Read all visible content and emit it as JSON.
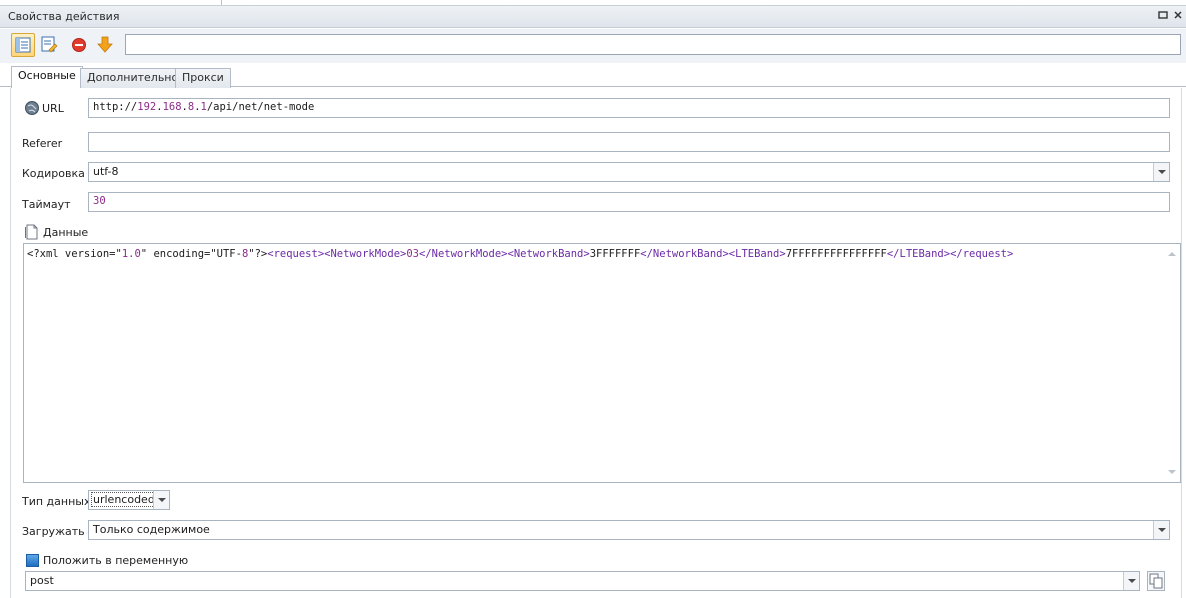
{
  "window": {
    "title": "Свойства действия"
  },
  "tabs": [
    {
      "label": "Основные"
    },
    {
      "label": "Дополнительно"
    },
    {
      "label": "Прокси"
    }
  ],
  "form": {
    "url_label": "URL",
    "url_prefix": "http://",
    "url_ip_a": "192",
    "url_dot1": ".",
    "url_ip_b": "168",
    "url_dot2": ".",
    "url_ip_c": "8",
    "url_dot3": ".",
    "url_ip_d": "1",
    "url_path": "/api/net/net-mode",
    "referer_label": "Referer",
    "referer_value": "",
    "encoding_label": "Кодировка",
    "encoding_value": "utf-8",
    "timeout_label": "Таймаут",
    "timeout_value": "30",
    "data_label": "Данные",
    "data_tokens": [
      {
        "t": "<?xml version=\"",
        "c": "txt"
      },
      {
        "t": "1.0",
        "c": "num"
      },
      {
        "t": "\" encoding=\"UTF-",
        "c": "txt"
      },
      {
        "t": "8",
        "c": "num"
      },
      {
        "t": "\"?>",
        "c": "txt"
      },
      {
        "t": "<request>",
        "c": "tag"
      },
      {
        "t": "<NetworkMode>",
        "c": "tag"
      },
      {
        "t": "03",
        "c": "num"
      },
      {
        "t": "</NetworkMode>",
        "c": "tag"
      },
      {
        "t": "<NetworkBand>",
        "c": "tag"
      },
      {
        "t": "3FFFFFFF",
        "c": "txt"
      },
      {
        "t": "</NetworkBand>",
        "c": "tag"
      },
      {
        "t": "<LTEBand>",
        "c": "tag"
      },
      {
        "t": "7FFFFFFFFFFFFFFF",
        "c": "txt"
      },
      {
        "t": "</LTEBand>",
        "c": "tag"
      },
      {
        "t": "</request>",
        "c": "tag"
      }
    ],
    "datatype_label": "Тип данных",
    "datatype_value": "urlencoded",
    "load_label": "Загружать",
    "load_value": "Только содержимое",
    "store_label": "Положить в переменную",
    "store_value": "post"
  },
  "colors": {
    "accent": "#1f6fc2",
    "stop": "#e23b2e",
    "arrow": "#f3a21b"
  }
}
